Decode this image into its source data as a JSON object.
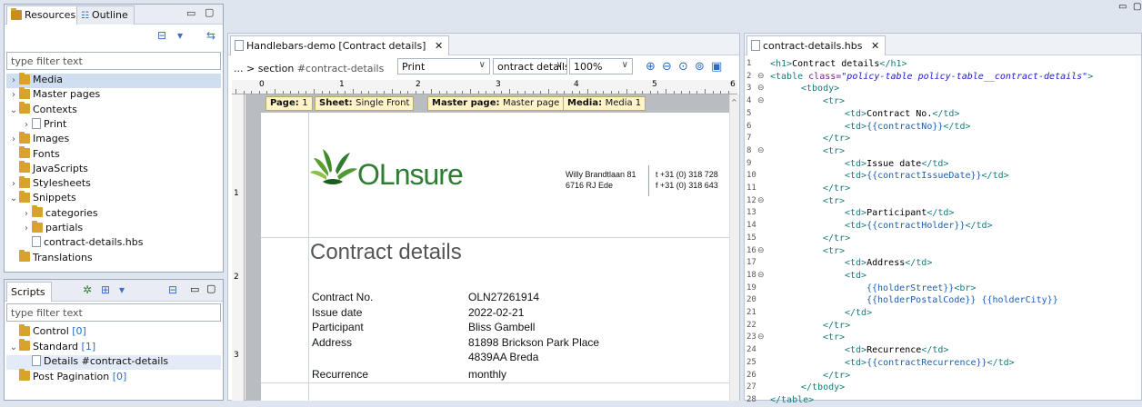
{
  "left_top_panel": {
    "tabs": [
      "Resources",
      "Outline"
    ],
    "filter_placeholder": "type filter text",
    "tree": [
      {
        "label": "Media",
        "arrow": ">",
        "icon": "folder",
        "selected": true
      },
      {
        "label": "Master pages",
        "arrow": ">",
        "icon": "folder"
      },
      {
        "label": "Contexts",
        "arrow": "v",
        "icon": "folder"
      },
      {
        "label": "Print",
        "arrow": ">",
        "icon": "file",
        "indent": 1
      },
      {
        "label": "Images",
        "arrow": ">",
        "icon": "folder"
      },
      {
        "label": "Fonts",
        "arrow": "",
        "icon": "folder"
      },
      {
        "label": "JavaScripts",
        "arrow": "",
        "icon": "folder"
      },
      {
        "label": "Stylesheets",
        "arrow": ">",
        "icon": "folder"
      },
      {
        "label": "Snippets",
        "arrow": "v",
        "icon": "folder"
      },
      {
        "label": "categories",
        "arrow": ">",
        "icon": "folder",
        "indent": 1
      },
      {
        "label": "partials",
        "arrow": ">",
        "icon": "folder",
        "indent": 1
      },
      {
        "label": "contract-details.hbs",
        "arrow": "",
        "icon": "file",
        "indent": 1
      },
      {
        "label": "Translations",
        "arrow": "",
        "icon": "folder"
      }
    ]
  },
  "left_bottom_panel": {
    "tab": "Scripts",
    "filter_placeholder": "type filter text",
    "tree": [
      {
        "label": "Control",
        "count": "[0]",
        "arrow": "",
        "icon": "folder"
      },
      {
        "label": "Standard",
        "count": "[1]",
        "arrow": "v",
        "icon": "folder"
      },
      {
        "label": "Details #contract-details",
        "count": "",
        "arrow": "",
        "icon": "file",
        "indent": 1,
        "selected": true
      },
      {
        "label": "Post Pagination",
        "count": "[0]",
        "arrow": "",
        "icon": "folder"
      }
    ]
  },
  "editor": {
    "tab": "Handlebars-demo [Contract details]",
    "breadcrumb_prefix": "... > section",
    "breadcrumb_id": "#contract-details",
    "context_select": "Print",
    "section_select": "ontract details",
    "zoom_select": "100%",
    "ruler_numbers": [
      "0",
      "1",
      "2",
      "3",
      "4",
      "5",
      "6"
    ],
    "vruler_numbers": [
      "1",
      "2",
      "3"
    ],
    "badges": [
      {
        "key": "Page:",
        "value": "1"
      },
      {
        "key": "Sheet:",
        "value": "Single Front"
      },
      {
        "key": "Master page:",
        "value": "Master page 1"
      },
      {
        "key": "Media:",
        "value": "Media 1"
      }
    ],
    "logo_text": "OLnsure",
    "address": [
      "Willy Brandtlaan 81",
      "6716 RJ Ede"
    ],
    "contact": [
      "t  +31 (0) 318 728",
      "f  +31 (0) 318 643"
    ],
    "heading": "Contract details",
    "fields": [
      {
        "label": "Contract No.",
        "value": "OLN27261914"
      },
      {
        "label": "Issue date",
        "value": "2022-02-21"
      },
      {
        "label": "Participant",
        "value": "Bliss Gambell"
      },
      {
        "label": "Address",
        "value": "81898 Brickson Park Place"
      },
      {
        "label": "",
        "value": "4839AA Breda"
      },
      {
        "label": "Recurrence",
        "value": "monthly"
      }
    ]
  },
  "code_editor": {
    "tab": "contract-details.hbs",
    "lines": [
      {
        "n": "1",
        "fold": "",
        "indent": 0,
        "parts": [
          [
            "tag",
            "<h1>"
          ],
          [
            "txt",
            "Contract details"
          ],
          [
            "tag",
            "</h1>"
          ]
        ]
      },
      {
        "n": "2",
        "fold": "⊖",
        "indent": 0,
        "parts": [
          [
            "tag",
            "<table "
          ],
          [
            "attr",
            "class="
          ],
          [
            "str",
            "\"policy-table policy-table__contract-details\""
          ],
          [
            "tag",
            ">"
          ]
        ]
      },
      {
        "n": "3",
        "fold": "⊖",
        "indent": 1,
        "parts": [
          [
            "tag",
            "<tbody>"
          ]
        ]
      },
      {
        "n": "4",
        "fold": "⊖",
        "indent": 2,
        "parts": [
          [
            "tag",
            "<tr>"
          ]
        ]
      },
      {
        "n": "5",
        "fold": "",
        "indent": 3,
        "parts": [
          [
            "tag",
            "<td>"
          ],
          [
            "txt",
            "Contract No."
          ],
          [
            "tag",
            "</td>"
          ]
        ]
      },
      {
        "n": "6",
        "fold": "",
        "indent": 3,
        "parts": [
          [
            "tag",
            "<td>"
          ],
          [
            "hb",
            "{{contractNo}}"
          ],
          [
            "tag",
            "</td>"
          ]
        ]
      },
      {
        "n": "7",
        "fold": "",
        "indent": 2,
        "parts": [
          [
            "tag",
            "</tr>"
          ]
        ]
      },
      {
        "n": "8",
        "fold": "⊖",
        "indent": 2,
        "parts": [
          [
            "tag",
            "<tr>"
          ]
        ]
      },
      {
        "n": "9",
        "fold": "",
        "indent": 3,
        "parts": [
          [
            "tag",
            "<td>"
          ],
          [
            "txt",
            "Issue date"
          ],
          [
            "tag",
            "</td>"
          ]
        ]
      },
      {
        "n": "10",
        "fold": "",
        "indent": 3,
        "parts": [
          [
            "tag",
            "<td>"
          ],
          [
            "hb",
            "{{contractIssueDate}}"
          ],
          [
            "tag",
            "</td>"
          ]
        ]
      },
      {
        "n": "11",
        "fold": "",
        "indent": 2,
        "parts": [
          [
            "tag",
            "</tr>"
          ]
        ]
      },
      {
        "n": "12",
        "fold": "⊖",
        "indent": 2,
        "parts": [
          [
            "tag",
            "<tr>"
          ]
        ]
      },
      {
        "n": "13",
        "fold": "",
        "indent": 3,
        "parts": [
          [
            "tag",
            "<td>"
          ],
          [
            "txt",
            "Participant"
          ],
          [
            "tag",
            "</td>"
          ]
        ]
      },
      {
        "n": "14",
        "fold": "",
        "indent": 3,
        "parts": [
          [
            "tag",
            "<td>"
          ],
          [
            "hb",
            "{{contractHolder}}"
          ],
          [
            "tag",
            "</td>"
          ]
        ]
      },
      {
        "n": "15",
        "fold": "",
        "indent": 2,
        "parts": [
          [
            "tag",
            "</tr>"
          ]
        ]
      },
      {
        "n": "16",
        "fold": "⊖",
        "indent": 2,
        "parts": [
          [
            "tag",
            "<tr>"
          ]
        ]
      },
      {
        "n": "17",
        "fold": "",
        "indent": 3,
        "parts": [
          [
            "tag",
            "<td>"
          ],
          [
            "txt",
            "Address"
          ],
          [
            "tag",
            "</td>"
          ]
        ]
      },
      {
        "n": "18",
        "fold": "⊖",
        "indent": 3,
        "parts": [
          [
            "tag",
            "<td>"
          ]
        ]
      },
      {
        "n": "19",
        "fold": "",
        "indent": 4,
        "parts": [
          [
            "hb",
            "{{holderStreet}}"
          ],
          [
            "tag",
            "<br>"
          ]
        ]
      },
      {
        "n": "20",
        "fold": "",
        "indent": 4,
        "parts": [
          [
            "hb",
            "{{holderPostalCode}}"
          ],
          [
            "txt",
            " "
          ],
          [
            "hb",
            "{{holderCity}}"
          ]
        ]
      },
      {
        "n": "21",
        "fold": "",
        "indent": 3,
        "parts": [
          [
            "tag",
            "</td>"
          ]
        ]
      },
      {
        "n": "22",
        "fold": "",
        "indent": 2,
        "parts": [
          [
            "tag",
            "</tr>"
          ]
        ]
      },
      {
        "n": "23",
        "fold": "⊖",
        "indent": 2,
        "parts": [
          [
            "tag",
            "<tr>"
          ]
        ]
      },
      {
        "n": "24",
        "fold": "",
        "indent": 3,
        "parts": [
          [
            "tag",
            "<td>"
          ],
          [
            "txt",
            "Recurrence"
          ],
          [
            "tag",
            "</td>"
          ]
        ]
      },
      {
        "n": "25",
        "fold": "",
        "indent": 3,
        "parts": [
          [
            "tag",
            "<td>"
          ],
          [
            "hb",
            "{{contractRecurrence}}"
          ],
          [
            "tag",
            "</td>"
          ]
        ]
      },
      {
        "n": "26",
        "fold": "",
        "indent": 2,
        "parts": [
          [
            "tag",
            "</tr>"
          ]
        ]
      },
      {
        "n": "27",
        "fold": "",
        "indent": 1,
        "parts": [
          [
            "tag",
            "</tbody>"
          ]
        ]
      },
      {
        "n": "28",
        "fold": "",
        "indent": 0,
        "parts": [
          [
            "tag",
            "</table>"
          ]
        ]
      }
    ]
  }
}
